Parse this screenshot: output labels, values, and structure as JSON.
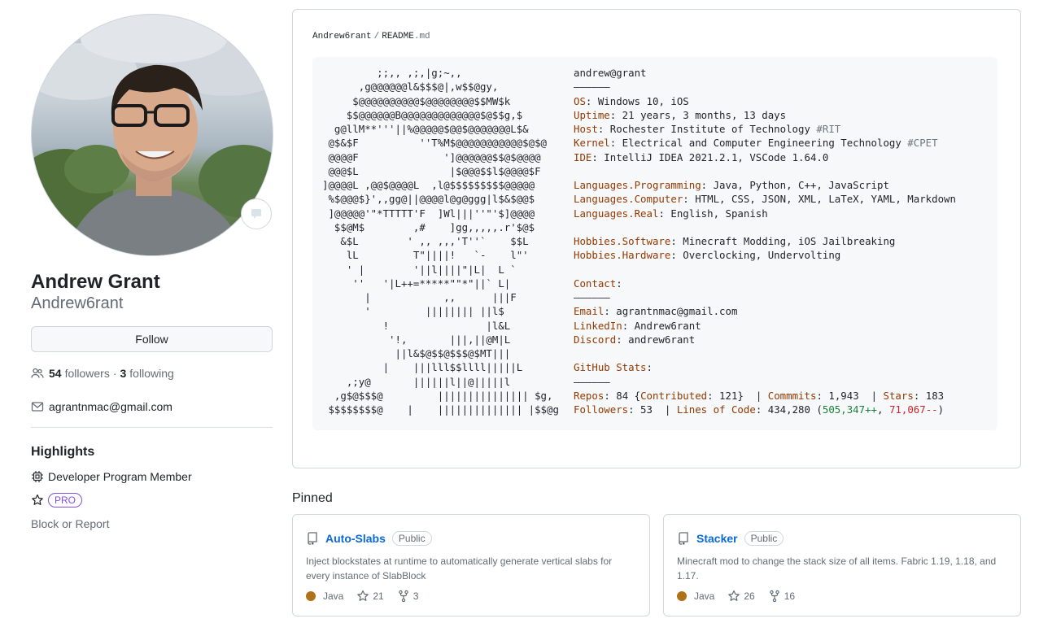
{
  "profile": {
    "name": "Andrew Grant",
    "login": "Andrew6rant",
    "follow_label": "Follow",
    "followers_count": "54",
    "followers_label": "followers",
    "separator": "·",
    "following_count": "3",
    "following_label": "following",
    "email": "agrantnmac@gmail.com"
  },
  "highlights": {
    "title": "Highlights",
    "developer_program": "Developer Program Member",
    "pro_badge": "PRO",
    "block_report": "Block or Report"
  },
  "readme": {
    "owner": "Andrew6rant",
    "separator": "/",
    "file_base": "README",
    "file_ext": ".md",
    "ascii_art": "         ;;,, ,;,|g;~,,\n      ,g@@@@@@l&$$$@|,w$$@gy,\n     $@@@@@@@@@@$@@@@@@@@$$MW$k\n    $$@@@@@@B@@@@@@@@@@@@@$@$$g,$\n  g@llM**'''||%@@@@@$@@$@@@@@@@L$&\n @$&$F          ''T%M$@@@@@@@@@@@$@$@\n @@@@F              ']@@@@@@$$@$@@@@\n @@@$L               |$@@@$$l$@@@@$F\n]@@@@L ,@@$@@@@L  ,l@$$$$$$$$$@@@@@\n %$@@@$}',,gg@||@@@@l@g@ggg|l$&$@@$\n ]@@@@@'\"*TTTTT'F  ]Wl|||''\"'$]@@@@\n  $$@M$        ,#    ]gg,,,,,.r'$@$\n   &$L        ' ,, ,,,'T''`    $$L\n    lL         T\"||||!   `-    l\"'\n    ' |        '||l||||\"|L|  L `\n     ''   '|L++=*****\"\"*\"||` L|\n       |            ,,      |||F\n       '         |||||||| ||l$\n          !                |l&L\n           '!,       |||,||@M|L\n            ||l&$@$$@$$$@$MT|||\n          |    |||lll$$llll|||||L\n    ,;y@       ||||||l||@|||||l\n  ,g$@$$$@         ||||||||||||||| $g,\n $$$$$$$$@    |    |||||||||||||| |$$@g",
    "info_lines": [
      {
        "parts": [
          {
            "t": "andrew@grant",
            "c": ""
          }
        ]
      },
      {
        "parts": [
          {
            "t": "――――――",
            "c": ""
          }
        ]
      },
      {
        "parts": [
          {
            "t": "OS",
            "c": "k"
          },
          {
            "t": ": Windows 10, iOS",
            "c": ""
          }
        ]
      },
      {
        "parts": [
          {
            "t": "Uptime",
            "c": "k"
          },
          {
            "t": ": 21 years, 3 months, 13 days",
            "c": ""
          }
        ]
      },
      {
        "parts": [
          {
            "t": "Host",
            "c": "k"
          },
          {
            "t": ": Rochester Institute of Technology ",
            "c": ""
          },
          {
            "t": "#RIT",
            "c": "c"
          }
        ]
      },
      {
        "parts": [
          {
            "t": "Kernel",
            "c": "k"
          },
          {
            "t": ": Electrical and Computer Engineering Technology ",
            "c": ""
          },
          {
            "t": "#CPET",
            "c": "c"
          }
        ]
      },
      {
        "parts": [
          {
            "t": "IDE",
            "c": "k"
          },
          {
            "t": ": IntelliJ IDEA 2021.2.1, VSCode 1.64.0",
            "c": ""
          }
        ]
      },
      {
        "parts": [
          {
            "t": "",
            "c": ""
          }
        ]
      },
      {
        "parts": [
          {
            "t": "Languages.Programming",
            "c": "k"
          },
          {
            "t": ": Java, Python, C++, JavaScript",
            "c": ""
          }
        ]
      },
      {
        "parts": [
          {
            "t": "Languages.Computer",
            "c": "k"
          },
          {
            "t": ": HTML, CSS, JSON, XML, LaTeX, YAML, Markdown",
            "c": ""
          }
        ]
      },
      {
        "parts": [
          {
            "t": "Languages.Real",
            "c": "k"
          },
          {
            "t": ": English, Spanish",
            "c": ""
          }
        ]
      },
      {
        "parts": [
          {
            "t": "",
            "c": ""
          }
        ]
      },
      {
        "parts": [
          {
            "t": "Hobbies.Software",
            "c": "k"
          },
          {
            "t": ": Minecraft Modding, iOS Jailbreaking",
            "c": ""
          }
        ]
      },
      {
        "parts": [
          {
            "t": "Hobbies.Hardware",
            "c": "k"
          },
          {
            "t": ": Overclocking, Undervolting",
            "c": ""
          }
        ]
      },
      {
        "parts": [
          {
            "t": "",
            "c": ""
          }
        ]
      },
      {
        "parts": [
          {
            "t": "Contact",
            "c": "k"
          },
          {
            "t": ":",
            "c": ""
          }
        ]
      },
      {
        "parts": [
          {
            "t": "――――――",
            "c": ""
          }
        ]
      },
      {
        "parts": [
          {
            "t": "Email",
            "c": "k"
          },
          {
            "t": ": agrantnmac@gmail.com",
            "c": ""
          }
        ]
      },
      {
        "parts": [
          {
            "t": "LinkedIn",
            "c": "k"
          },
          {
            "t": ": Andrew6rant",
            "c": ""
          }
        ]
      },
      {
        "parts": [
          {
            "t": "Discord",
            "c": "k"
          },
          {
            "t": ": andrew6rant",
            "c": ""
          }
        ]
      },
      {
        "parts": [
          {
            "t": "",
            "c": ""
          }
        ]
      },
      {
        "parts": [
          {
            "t": "GitHub Stats",
            "c": "k"
          },
          {
            "t": ":",
            "c": ""
          }
        ]
      },
      {
        "parts": [
          {
            "t": "――――――",
            "c": ""
          }
        ]
      },
      {
        "parts": [
          {
            "t": "Repos",
            "c": "k"
          },
          {
            "t": ": 84 {",
            "c": ""
          },
          {
            "t": "Contributed",
            "c": "k"
          },
          {
            "t": ": 121}  | ",
            "c": ""
          },
          {
            "t": "Commmits",
            "c": "k"
          },
          {
            "t": ": 1,943  | ",
            "c": ""
          },
          {
            "t": "Stars",
            "c": "k"
          },
          {
            "t": ": 183",
            "c": ""
          }
        ]
      },
      {
        "parts": [
          {
            "t": "Followers",
            "c": "k"
          },
          {
            "t": ": 53  | ",
            "c": ""
          },
          {
            "t": "Lines of Code",
            "c": "k"
          },
          {
            "t": ": 434,280 (",
            "c": ""
          },
          {
            "t": "505,347++",
            "c": "g"
          },
          {
            "t": ", ",
            "c": ""
          },
          {
            "t": "71,067--",
            "c": "r"
          },
          {
            "t": ")",
            "c": ""
          }
        ]
      }
    ]
  },
  "pinned": {
    "title": "Pinned",
    "repos": [
      {
        "name": "Auto-Slabs",
        "visibility": "Public",
        "description": "Inject blockstates at runtime to automatically generate vertical slabs for every instance of SlabBlock",
        "language": "Java",
        "language_color": "#b07219",
        "stars": "21",
        "forks": "3"
      },
      {
        "name": "Stacker",
        "visibility": "Public",
        "description": "Minecraft mod to change the stack size of all items. Fabric 1.19, 1.18, and 1.17.",
        "language": "Java",
        "language_color": "#b07219",
        "stars": "26",
        "forks": "16"
      }
    ]
  },
  "icons": {
    "people": "people-icon",
    "mail": "mail-icon",
    "chip": "cpu-icon",
    "star": "star-icon",
    "repo": "repo-icon",
    "fork": "fork-icon",
    "status": "smiley-status-icon"
  }
}
